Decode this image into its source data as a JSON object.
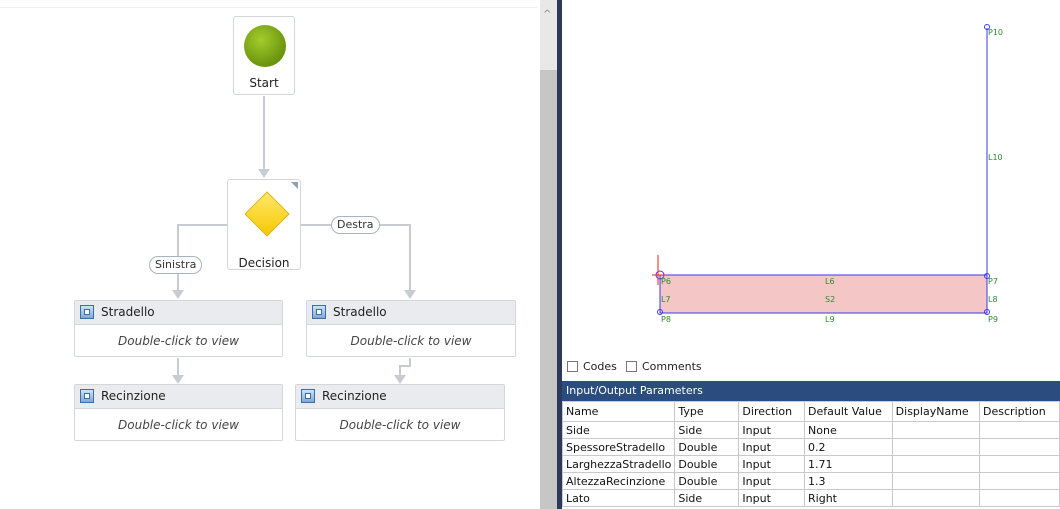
{
  "workflow": {
    "start_label": "Start",
    "decision_label": "Decision",
    "branch_left": "Sinistra",
    "branch_right": "Destra",
    "activities": [
      {
        "title": "Stradello",
        "body": "Double-click to view"
      },
      {
        "title": "Recinzione",
        "body": "Double-click to view"
      },
      {
        "title": "Stradello",
        "body": "Double-click to view"
      },
      {
        "title": "Recinzione",
        "body": "Double-click to view"
      }
    ]
  },
  "cad": {
    "points": [
      "P6",
      "P7",
      "P8",
      "P9",
      "P10"
    ],
    "lines": [
      "L6",
      "L7",
      "L8",
      "L9",
      "L10"
    ],
    "surface": "S2"
  },
  "toggles": {
    "codes": "Codes",
    "comments": "Comments"
  },
  "params": {
    "title": "Input/Output Parameters",
    "columns": [
      "Name",
      "Type",
      "Direction",
      "Default Value",
      "DisplayName",
      "Description"
    ],
    "rows": [
      [
        "Side",
        "Side",
        "Input",
        "None",
        "",
        ""
      ],
      [
        "SpessoreStradello",
        "Double",
        "Input",
        "0.2",
        "",
        ""
      ],
      [
        "LarghezzaStradello",
        "Double",
        "Input",
        "1.71",
        "",
        ""
      ],
      [
        "AltezzaRecinzione",
        "Double",
        "Input",
        "1.3",
        "",
        ""
      ],
      [
        "Lato",
        "Side",
        "Input",
        "Right",
        "",
        ""
      ]
    ]
  },
  "colors": {
    "accent": "#2b4c7e",
    "surface_fill": "#f5c6c6",
    "cad_line": "#3a3af0",
    "cad_text": "#2e8b2e"
  }
}
